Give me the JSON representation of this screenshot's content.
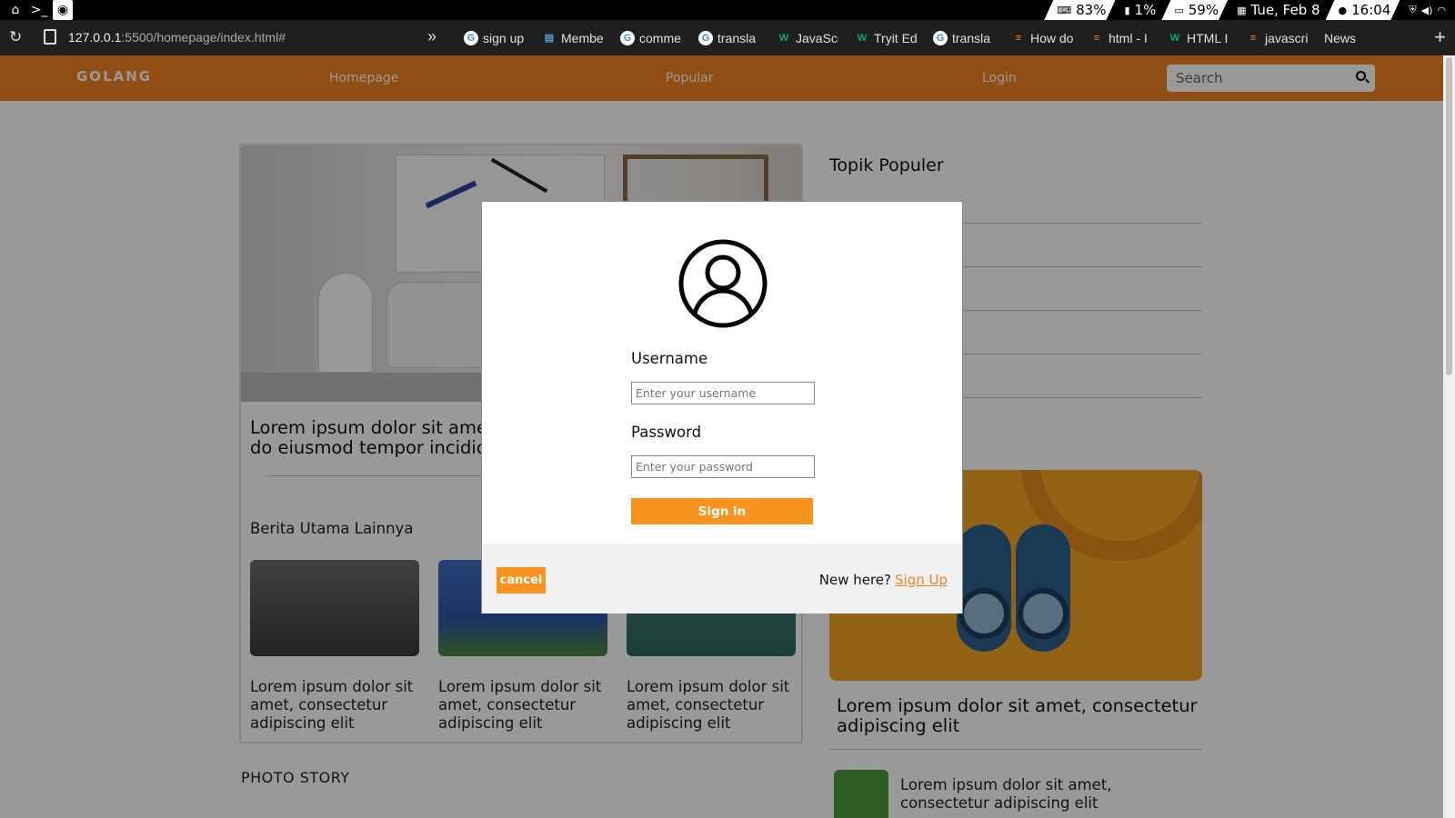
{
  "system_bar": {
    "keyboard_level": "83%",
    "cpu": "1%",
    "battery": "59%",
    "date": "Tue, Feb  8",
    "time": "16:04"
  },
  "browser": {
    "url_host": "127.0.0.1",
    "url_path": ":5500/homepage/index.html#",
    "bookmarks": [
      {
        "label": "sign up",
        "icon": "google-icon",
        "color": "#ffffff"
      },
      {
        "label": "Membe",
        "icon": "stack-icon",
        "color": "#5b9bd5"
      },
      {
        "label": "comme",
        "icon": "google-icon",
        "color": "#ffffff"
      },
      {
        "label": "transla",
        "icon": "google-icon",
        "color": "#ffffff"
      },
      {
        "label": "JavaScr",
        "icon": "w3schools-icon",
        "color": "#04aa6d"
      },
      {
        "label": "Tryit Ed",
        "icon": "w3schools-icon",
        "color": "#04aa6d"
      },
      {
        "label": "transla",
        "icon": "google-icon",
        "color": "#ffffff"
      },
      {
        "label": "How do",
        "icon": "stackoverflow-icon",
        "color": "#f48024"
      },
      {
        "label": "html - I",
        "icon": "stackoverflow-icon",
        "color": "#f48024"
      },
      {
        "label": "HTML I",
        "icon": "w3schools-icon",
        "color": "#04aa6d"
      },
      {
        "label": "javascri",
        "icon": "stackoverflow-icon",
        "color": "#f48024"
      },
      {
        "label": "News",
        "icon": "",
        "color": ""
      }
    ]
  },
  "site": {
    "brand": "GOLANG",
    "nav": [
      "Homepage",
      "Popular",
      "Login"
    ],
    "search_placeholder": "Search",
    "accent": "#f28221"
  },
  "main": {
    "headline": "Lorem ipsum dolor sit amet, consectetur adipiscing elit, sed do eiusmod tempor incididunt",
    "section_title": "Berita Utama Lainnya",
    "thumbs": [
      {
        "caption": "Lorem ipsum dolor sit amet, consectetur adipiscing elit"
      },
      {
        "caption": "Lorem ipsum dolor sit amet, consectetur adipiscing elit"
      },
      {
        "caption": "Lorem ipsum dolor sit amet, consectetur adipiscing elit"
      }
    ],
    "photo_story": "PHOTO STORY"
  },
  "sidebar": {
    "title": "Topik Populer",
    "feature_caption": "Lorem ipsum dolor sit amet, consectetur adipiscing elit",
    "mini_caption": "Lorem ipsum dolor sit amet, consectetur adipiscing elit"
  },
  "modal": {
    "username_label": "Username",
    "username_placeholder": "Enter your username",
    "password_label": "Password",
    "password_placeholder": "Enter your password",
    "signin_label": "Sign in",
    "cancel_label": "cancel",
    "new_here": "New here?",
    "signup_link": "Sign Up"
  }
}
